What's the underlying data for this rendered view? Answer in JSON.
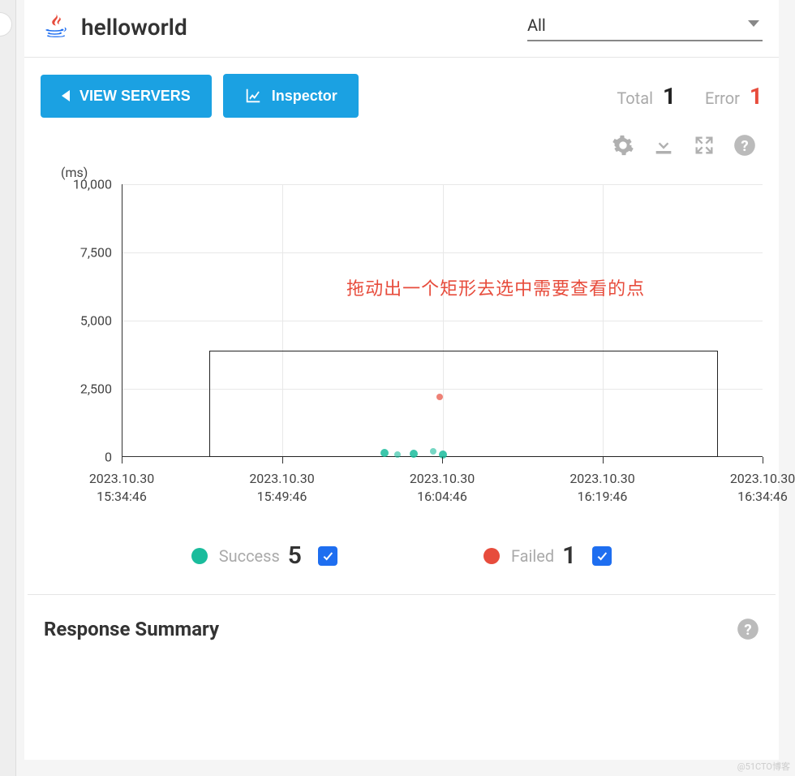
{
  "header": {
    "title": "helloworld",
    "select_value": "All"
  },
  "toolbar": {
    "view_servers": "VIEW SERVERS",
    "inspector": "Inspector",
    "total_label": "Total",
    "total_value": "1",
    "error_label": "Error",
    "error_value": "1"
  },
  "annotation": "拖动出一个矩形去选中需要查看的点",
  "legend": {
    "success_label": "Success",
    "success_value": "5",
    "failed_label": "Failed",
    "failed_value": "1"
  },
  "summary": {
    "title": "Response Summary"
  },
  "watermark": "@51CTO博客",
  "chart_data": {
    "type": "scatter",
    "ylabel": "(ms)",
    "ylim": [
      0,
      10000
    ],
    "yticks": [
      0,
      2500,
      5000,
      7500,
      10000
    ],
    "xticks": [
      {
        "date": "2023.10.30",
        "time": "15:34:46"
      },
      {
        "date": "2023.10.30",
        "time": "15:49:46"
      },
      {
        "date": "2023.10.30",
        "time": "16:04:46"
      },
      {
        "date": "2023.10.30",
        "time": "16:19:46"
      },
      {
        "date": "2023.10.30",
        "time": "16:34:46"
      }
    ],
    "series": [
      {
        "name": "Success",
        "color": "#1abc9c",
        "points": [
          {
            "x_frac": 0.41,
            "y": 150
          },
          {
            "x_frac": 0.43,
            "y": 100
          },
          {
            "x_frac": 0.455,
            "y": 120
          },
          {
            "x_frac": 0.485,
            "y": 200
          },
          {
            "x_frac": 0.5,
            "y": 100
          }
        ]
      },
      {
        "name": "Failed",
        "color": "#e74c3c",
        "points": [
          {
            "x_frac": 0.495,
            "y": 2200
          }
        ]
      }
    ],
    "selection_box": {
      "x0_frac": 0.135,
      "x1_frac": 0.93,
      "y0": 0,
      "y1": 3900
    }
  }
}
